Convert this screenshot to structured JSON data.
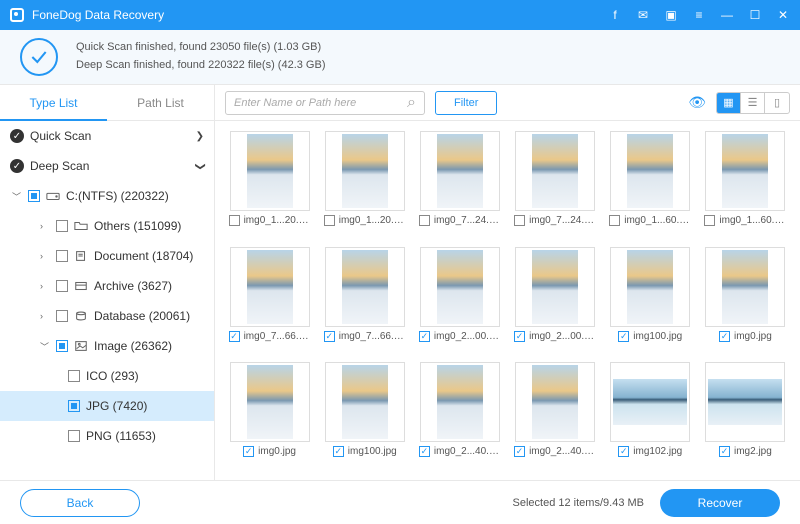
{
  "app_title": "FoneDog Data Recovery",
  "status": {
    "line1": "Quick Scan finished, found 23050 file(s) (1.03 GB)",
    "line2": "Deep Scan finished, found 220322 file(s) (42.3 GB)"
  },
  "sidebar": {
    "tabs": {
      "type_list": "Type List",
      "path_list": "Path List"
    },
    "quick_scan": "Quick Scan",
    "deep_scan": "Deep Scan",
    "drive": "C:(NTFS) (220322)",
    "others": "Others (151099)",
    "document": "Document (18704)",
    "archive": "Archive (3627)",
    "database": "Database (20061)",
    "image": "Image (26362)",
    "ico": "ICO (293)",
    "jpg": "JPG (7420)",
    "png": "PNG (11653)"
  },
  "toolbar": {
    "search_placeholder": "Enter Name or Path here",
    "filter": "Filter"
  },
  "grid": [
    {
      "name": "img0_1...20.jpg",
      "checked": false,
      "wide": false
    },
    {
      "name": "img0_1...20.jpg",
      "checked": false,
      "wide": false
    },
    {
      "name": "img0_7...24.jpg",
      "checked": false,
      "wide": false
    },
    {
      "name": "img0_7...24.jpg",
      "checked": false,
      "wide": false
    },
    {
      "name": "img0_1...60.jpg",
      "checked": false,
      "wide": false
    },
    {
      "name": "img0_1...60.jpg",
      "checked": false,
      "wide": false
    },
    {
      "name": "img0_7...66.jpg",
      "checked": true,
      "wide": false
    },
    {
      "name": "img0_7...66.jpg",
      "checked": true,
      "wide": false
    },
    {
      "name": "img0_2...00.jpg",
      "checked": true,
      "wide": false
    },
    {
      "name": "img0_2...00.jpg",
      "checked": true,
      "wide": false
    },
    {
      "name": "img100.jpg",
      "checked": true,
      "wide": false
    },
    {
      "name": "img0.jpg",
      "checked": true,
      "wide": false
    },
    {
      "name": "img0.jpg",
      "checked": true,
      "wide": false
    },
    {
      "name": "img100.jpg",
      "checked": true,
      "wide": false
    },
    {
      "name": "img0_2...40.jpg",
      "checked": true,
      "wide": false
    },
    {
      "name": "img0_2...40.jpg",
      "checked": true,
      "wide": false
    },
    {
      "name": "img102.jpg",
      "checked": true,
      "wide": true
    },
    {
      "name": "img2.jpg",
      "checked": true,
      "wide": true
    }
  ],
  "footer": {
    "back": "Back",
    "info": "Selected 12 items/9.43 MB",
    "recover": "Recover"
  }
}
